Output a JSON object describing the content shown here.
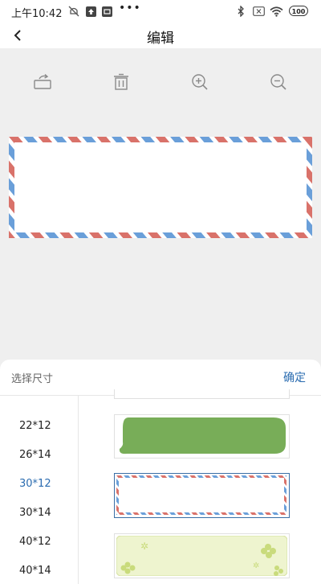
{
  "status_bar": {
    "time": "上午10:42",
    "battery": "100",
    "icons": [
      "mute-icon",
      "upload-icon",
      "app-icon",
      "more-dots-icon",
      "bluetooth-icon",
      "sim-icon",
      "wifi-icon",
      "battery-icon"
    ]
  },
  "header": {
    "title": "编辑",
    "back_icon": "back-arrow-icon"
  },
  "toolbar": {
    "icons": [
      "rotate-icon",
      "delete-icon",
      "zoom-in-icon",
      "zoom-out-icon"
    ]
  },
  "colors": {
    "accent": "#2b6cb0",
    "stripe_red": "#d9726a",
    "stripe_blue": "#6a9fd9",
    "green_bubble": "#78ad58",
    "clover_bg": "#eef4cf"
  },
  "sheet": {
    "title": "选择尺寸",
    "confirm": "确定",
    "sizes": [
      {
        "label": "22*12",
        "selected": false
      },
      {
        "label": "26*14",
        "selected": false
      },
      {
        "label": "30*12",
        "selected": true
      },
      {
        "label": "30*14",
        "selected": false
      },
      {
        "label": "40*12",
        "selected": false
      },
      {
        "label": "40*14",
        "selected": false
      }
    ],
    "templates": [
      "blank",
      "green-speech-bubble",
      "airmail-border",
      "clover-pattern"
    ]
  }
}
